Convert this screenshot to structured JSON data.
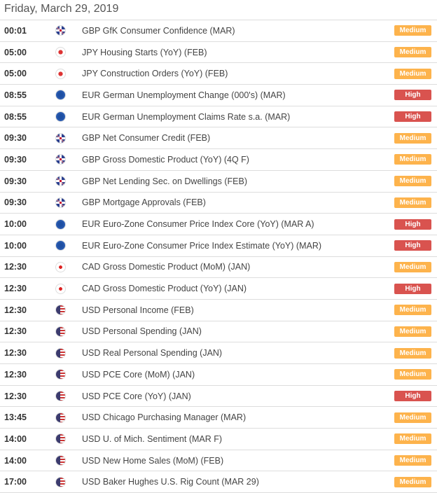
{
  "date": "Friday, March 29, 2019",
  "colors": {
    "Medium": "#fdb34c",
    "High": "#d9534f"
  },
  "events": [
    {
      "time": "00:01",
      "flag": "GBP",
      "title": "GBP GfK Consumer Confidence (MAR)",
      "impact": "Medium"
    },
    {
      "time": "05:00",
      "flag": "JPY",
      "title": "JPY Housing Starts (YoY) (FEB)",
      "impact": "Medium"
    },
    {
      "time": "05:00",
      "flag": "JPY",
      "title": "JPY Construction Orders (YoY) (FEB)",
      "impact": "Medium"
    },
    {
      "time": "08:55",
      "flag": "EUR",
      "title": "EUR German Unemployment Change (000's) (MAR)",
      "impact": "High"
    },
    {
      "time": "08:55",
      "flag": "EUR",
      "title": "EUR German Unemployment Claims Rate s.a. (MAR)",
      "impact": "High"
    },
    {
      "time": "09:30",
      "flag": "GBP",
      "title": "GBP Net Consumer Credit (FEB)",
      "impact": "Medium"
    },
    {
      "time": "09:30",
      "flag": "GBP",
      "title": "GBP Gross Domestic Product (YoY) (4Q F)",
      "impact": "Medium"
    },
    {
      "time": "09:30",
      "flag": "GBP",
      "title": "GBP Net Lending Sec. on Dwellings (FEB)",
      "impact": "Medium"
    },
    {
      "time": "09:30",
      "flag": "GBP",
      "title": "GBP Mortgage Approvals (FEB)",
      "impact": "Medium"
    },
    {
      "time": "10:00",
      "flag": "EUR",
      "title": "EUR Euro-Zone Consumer Price Index Core (YoY) (MAR A)",
      "impact": "High"
    },
    {
      "time": "10:00",
      "flag": "EUR",
      "title": "EUR Euro-Zone Consumer Price Index Estimate (YoY) (MAR)",
      "impact": "High"
    },
    {
      "time": "12:30",
      "flag": "CAD",
      "title": "CAD Gross Domestic Product (MoM) (JAN)",
      "impact": "Medium"
    },
    {
      "time": "12:30",
      "flag": "CAD",
      "title": "CAD Gross Domestic Product (YoY) (JAN)",
      "impact": "High"
    },
    {
      "time": "12:30",
      "flag": "USD",
      "title": "USD Personal Income (FEB)",
      "impact": "Medium"
    },
    {
      "time": "12:30",
      "flag": "USD",
      "title": "USD Personal Spending (JAN)",
      "impact": "Medium"
    },
    {
      "time": "12:30",
      "flag": "USD",
      "title": "USD Real Personal Spending (JAN)",
      "impact": "Medium"
    },
    {
      "time": "12:30",
      "flag": "USD",
      "title": "USD PCE Core (MoM) (JAN)",
      "impact": "Medium"
    },
    {
      "time": "12:30",
      "flag": "USD",
      "title": "USD PCE Core (YoY) (JAN)",
      "impact": "High"
    },
    {
      "time": "13:45",
      "flag": "USD",
      "title": "USD Chicago Purchasing Manager (MAR)",
      "impact": "Medium"
    },
    {
      "time": "14:00",
      "flag": "USD",
      "title": "USD U. of Mich. Sentiment (MAR F)",
      "impact": "Medium"
    },
    {
      "time": "14:00",
      "flag": "USD",
      "title": "USD New Home Sales (MoM) (FEB)",
      "impact": "Medium"
    },
    {
      "time": "17:00",
      "flag": "USD",
      "title": "USD Baker Hughes U.S. Rig Count (MAR 29)",
      "impact": "Medium"
    }
  ]
}
